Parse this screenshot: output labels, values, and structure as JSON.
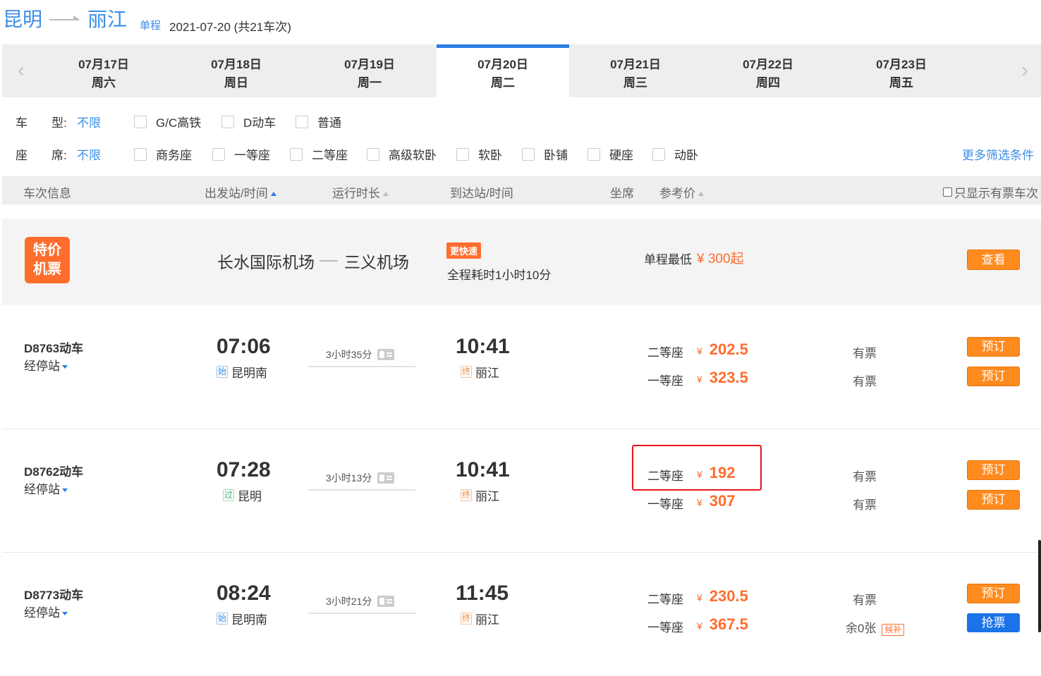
{
  "route": {
    "from": "昆明",
    "to": "丽江",
    "trip_type": "单程",
    "date_summary": "2021-07-20 (共21车次)"
  },
  "dates": [
    {
      "date": "07月17日",
      "weekday": "周六",
      "active": false
    },
    {
      "date": "07月18日",
      "weekday": "周日",
      "active": false
    },
    {
      "date": "07月19日",
      "weekday": "周一",
      "active": false
    },
    {
      "date": "07月20日",
      "weekday": "周二",
      "active": true
    },
    {
      "date": "07月21日",
      "weekday": "周三",
      "active": false
    },
    {
      "date": "07月22日",
      "weekday": "周四",
      "active": false
    },
    {
      "date": "07月23日",
      "weekday": "周五",
      "active": false
    }
  ],
  "date_nav": {
    "prev": "‹",
    "next": "›"
  },
  "filters": {
    "train_type_label_a": "车",
    "train_type_label_b": "型:",
    "train_type_limit": "不限",
    "train_types": [
      "G/C高铁",
      "D动车",
      "普通"
    ],
    "seat_label_a": "座",
    "seat_label_b": "席:",
    "seat_limit": "不限",
    "seats": [
      "商务座",
      "一等座",
      "二等座",
      "高级软卧",
      "软卧",
      "卧铺",
      "硬座",
      "动卧"
    ],
    "more": "更多筛选条件"
  },
  "columns": {
    "train_info": "车次信息",
    "depart": "出发站/时间",
    "duration": "运行时长",
    "arrive": "到达站/时间",
    "seat": "坐席",
    "price": "参考价",
    "only_available": "只显示有票车次"
  },
  "promo": {
    "badge_line1": "特价",
    "badge_line2": "机票",
    "from_airport": "长水国际机场",
    "to_airport": "三义机场",
    "fast_tag": "更快速",
    "fast_desc": "全程耗时1小时10分",
    "min_label": "单程最低",
    "min_price": "¥ 300起",
    "button": "查看"
  },
  "trains": [
    {
      "number": "D8763动车",
      "stops": "经停站",
      "depart_time": "07:06",
      "depart_tag": "始",
      "depart_station": "昆明南",
      "duration": "3小时35分",
      "arrive_time": "10:41",
      "arrive_tag": "终",
      "arrive_station": "丽江",
      "seats": [
        {
          "name": "二等座",
          "yen": "¥",
          "price": "202.5",
          "avail": "有票",
          "button": "预订"
        },
        {
          "name": "一等座",
          "yen": "¥",
          "price": "323.5",
          "avail": "有票",
          "button": "预订"
        }
      ]
    },
    {
      "number": "D8762动车",
      "stops": "经停站",
      "depart_time": "07:28",
      "depart_tag": "过",
      "depart_station": "昆明",
      "duration": "3小时13分",
      "arrive_time": "10:41",
      "arrive_tag": "终",
      "arrive_station": "丽江",
      "seats": [
        {
          "name": "二等座",
          "yen": "¥",
          "price": "192",
          "avail": "有票",
          "button": "预订"
        },
        {
          "name": "一等座",
          "yen": "¥",
          "price": "307",
          "avail": "有票",
          "button": "预订"
        }
      ]
    },
    {
      "number": "D8773动车",
      "stops": "经停站",
      "depart_time": "08:24",
      "depart_tag": "始",
      "depart_station": "昆明南",
      "duration": "3小时21分",
      "arrive_time": "11:45",
      "arrive_tag": "终",
      "arrive_station": "丽江",
      "seats": [
        {
          "name": "二等座",
          "yen": "¥",
          "price": "230.5",
          "avail": "有票",
          "button": "预订"
        },
        {
          "name": "一等座",
          "yen": "¥",
          "price": "367.5",
          "avail": "余0张",
          "waitlist": "候补",
          "button": "抢票"
        }
      ]
    }
  ],
  "colors": {
    "accent": "#2a7de1",
    "link": "#3a8ee6",
    "price": "#ff6d2d",
    "button_orange": "#ff8a1e",
    "button_blue": "#1a73e8",
    "highlight": "#e8151b"
  }
}
